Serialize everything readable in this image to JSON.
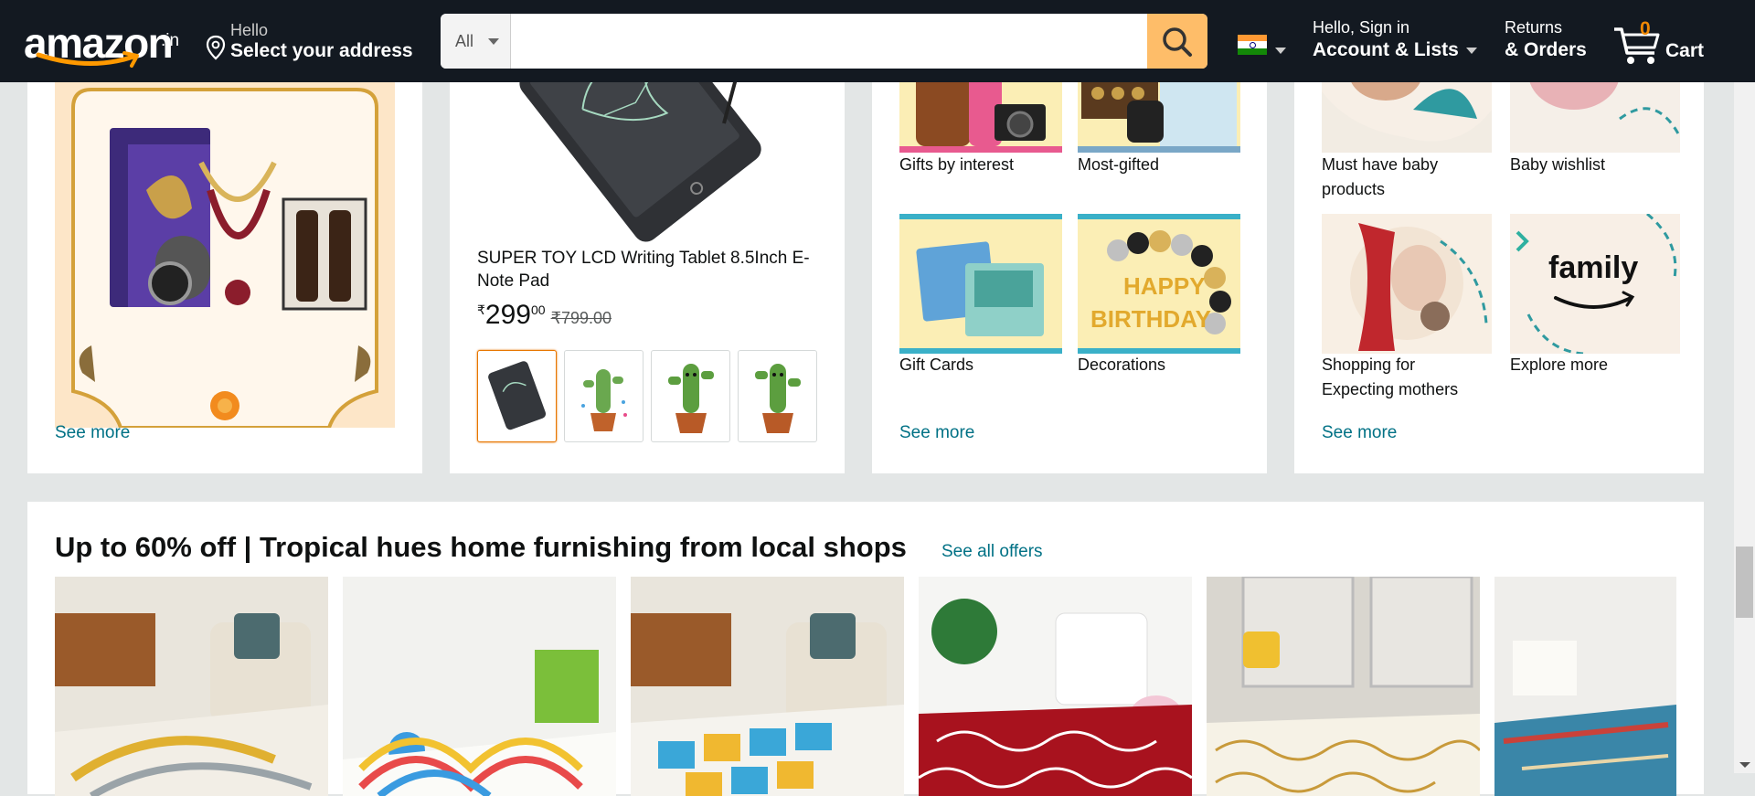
{
  "header": {
    "logo_text": "amazon",
    "logo_suffix": ".in",
    "address_line1": "Hello",
    "address_line2": "Select your address",
    "search_category": "All",
    "search_placeholder": "",
    "account_line1": "Hello, Sign in",
    "account_line2": "Account & Lists",
    "returns_line1": "Returns",
    "returns_line2": "& Orders",
    "cart_count": "0",
    "cart_label": "Cart"
  },
  "cards": {
    "gift_hero": {
      "see_more": "See more"
    },
    "product": {
      "title": "SUPER TOY LCD Writing Tablet 8.5Inch E-Note Pad",
      "price_symbol": "₹",
      "price_whole": "299",
      "price_fraction": "00",
      "mrp": "₹799.00"
    },
    "gifting": {
      "tiles": [
        "Gifts by interest",
        "Most-gifted",
        "Gift Cards",
        "Decorations"
      ],
      "see_more": "See more"
    },
    "baby": {
      "tiles": [
        "Must have baby products",
        "Baby wishlist",
        "Shopping for Expecting mothers",
        "Explore more"
      ],
      "family_text": "family",
      "see_more": "See more"
    }
  },
  "deals": {
    "title": "Up to 60% off | Tropical hues home furnishing from local shops",
    "link": "See all offers"
  },
  "colors": {
    "nav_bg": "#131921",
    "search_button": "#febd69",
    "link": "#007185",
    "cart_count": "#f08804"
  }
}
